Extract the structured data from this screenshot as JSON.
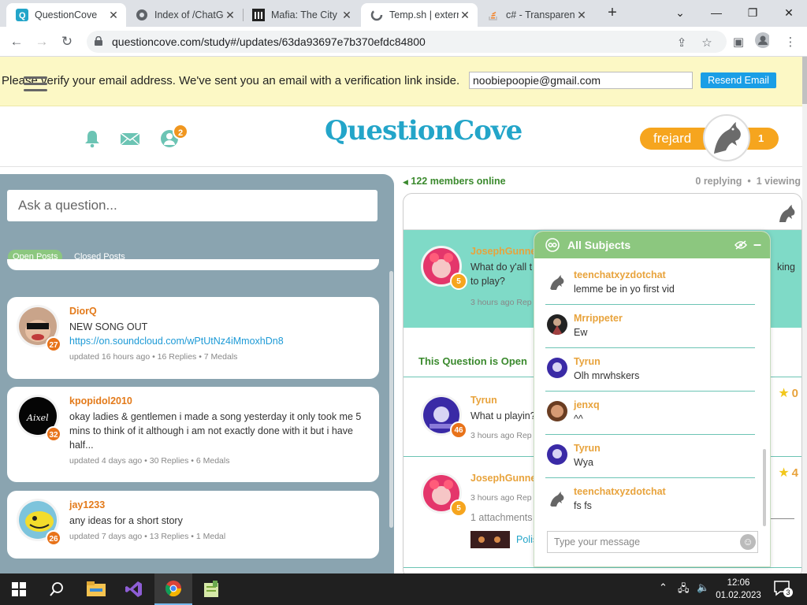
{
  "browser": {
    "tabs": [
      {
        "title": "QuestionCove",
        "active": true
      },
      {
        "title": "Index of /ChatG",
        "active": false
      },
      {
        "title": "Mafia: The City",
        "active": false
      },
      {
        "title": "Temp.sh | extern",
        "active": true
      },
      {
        "title": "c# - Transparen",
        "active": false
      }
    ],
    "url": "questioncove.com/study#/updates/63da93697e7b370efdc84800"
  },
  "banner": {
    "message": "Please verify your email address. We've sent you an email with a verification link inside.",
    "email_value": "noobiepoopie@gmail.com",
    "resend_label": "Resend Email"
  },
  "header": {
    "logo": "QuestionCove",
    "friends_count": "2",
    "username": "frejard",
    "user_level": "1"
  },
  "left": {
    "ask_placeholder": "Ask a question...",
    "tabs": {
      "open": "Open Posts",
      "closed": "Closed Posts"
    },
    "posts": [
      {
        "name": "DiorQ",
        "level": "27",
        "text": "NEW SONG OUT",
        "link": "https://on.soundcloud.com/wPtUtNz4iMmoxhDn8",
        "meta": "updated 16 hours ago  •  16 Replies  •  7 Medals"
      },
      {
        "name": "kpopidol2010",
        "level": "32",
        "text": "okay ladies & gentlemen i made a song yesterday it only took me 5 mins to think of it although i am not exactly done with it but i have half...",
        "meta": "updated 4 days ago  •  30 Replies  •  6 Medals"
      },
      {
        "name": "jay1233",
        "level": "26",
        "text": "any ideas for a short story",
        "meta": "updated 7 days ago  •  13 Replies  •  1 Medal"
      }
    ]
  },
  "feed": {
    "online": "122 members online",
    "replying": "0 replying",
    "viewing": "1 viewing",
    "question": {
      "name": "JosephGunne",
      "level": "5",
      "text_line1": "What do y'all t",
      "text_line2": "to play?",
      "text_right": "king",
      "meta": "3 hours ago  Rep"
    },
    "open_label": "This Question is Open",
    "replies": [
      {
        "name": "Tyrun",
        "level": "46",
        "text": "What u playin?",
        "meta": "3 hours ago  Rep",
        "medals": "0"
      },
      {
        "name": "JosephGunne",
        "level": "5",
        "meta": "3 hours ago  Rep",
        "attachments": "1 attachments",
        "attach_name": "Polis",
        "medals": "4"
      }
    ],
    "last_medals": "4"
  },
  "chat": {
    "title": "All Subjects",
    "messages": [
      {
        "name": "teenchatxyzdotchat",
        "text": "lemme be in yo first vid"
      },
      {
        "name": "Mrrippeter",
        "text": "Ew"
      },
      {
        "name": "Tyrun",
        "text": "Olh mrwhskers"
      },
      {
        "name": "jenxq",
        "text": "^^"
      },
      {
        "name": "Tyrun",
        "text": "Wya"
      },
      {
        "name": "teenchatxyzdotchat",
        "text": "fs fs"
      }
    ],
    "input_placeholder": "Type your message"
  },
  "taskbar": {
    "time": "12:06",
    "date": "01.02.2023",
    "notifications": "3"
  },
  "colors": {
    "accent_teal": "#23a5c9",
    "orange": "#f6a51e",
    "green": "#8cc77f",
    "mint": "#7fdac7"
  }
}
